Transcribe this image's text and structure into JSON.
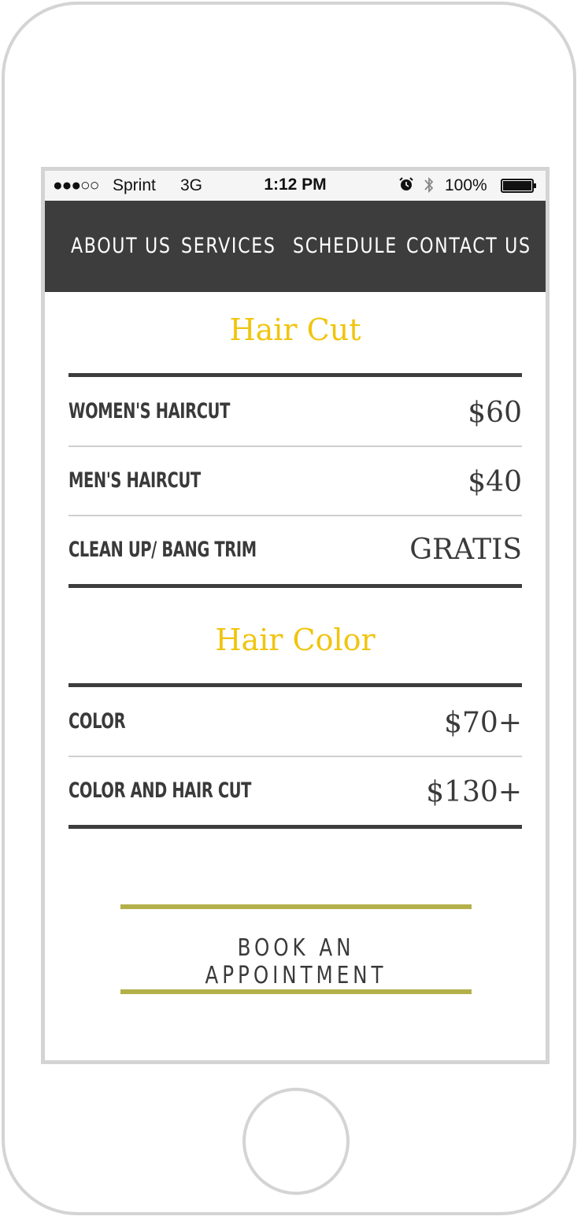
{
  "status_bar": {
    "signal": "●●●○○",
    "carrier": "Sprint",
    "network": "3G",
    "time": "1:12 PM",
    "battery": "100%",
    "icons": [
      "alarm-icon",
      "bluetooth-icon",
      "battery-icon"
    ]
  },
  "nav": {
    "items": [
      {
        "label": "ABOUT US"
      },
      {
        "label": "SERVICES"
      },
      {
        "label": "SCHEDULE"
      },
      {
        "label": "CONTACT US"
      }
    ]
  },
  "sections": [
    {
      "title": "Hair Cut",
      "items": [
        {
          "name": "WOMEN'S HAIRCUT",
          "price": "$60"
        },
        {
          "name": "MEN'S HAIRCUT",
          "price": "$40"
        },
        {
          "name": "CLEAN UP/ BANG TRIM",
          "price": "GRATIS"
        }
      ]
    },
    {
      "title": "Hair Color",
      "items": [
        {
          "name": "COLOR",
          "price": "$70+"
        },
        {
          "name": "COLOR AND HAIR CUT",
          "price": "$130+"
        }
      ]
    }
  ],
  "cta": {
    "label": "BOOK AN APPOINTMENT"
  },
  "colors": {
    "accent": "#f1c40f",
    "nav_bg": "#3d3d3d",
    "cta_line": "#b3b04a",
    "text": "#3a3a3a"
  }
}
